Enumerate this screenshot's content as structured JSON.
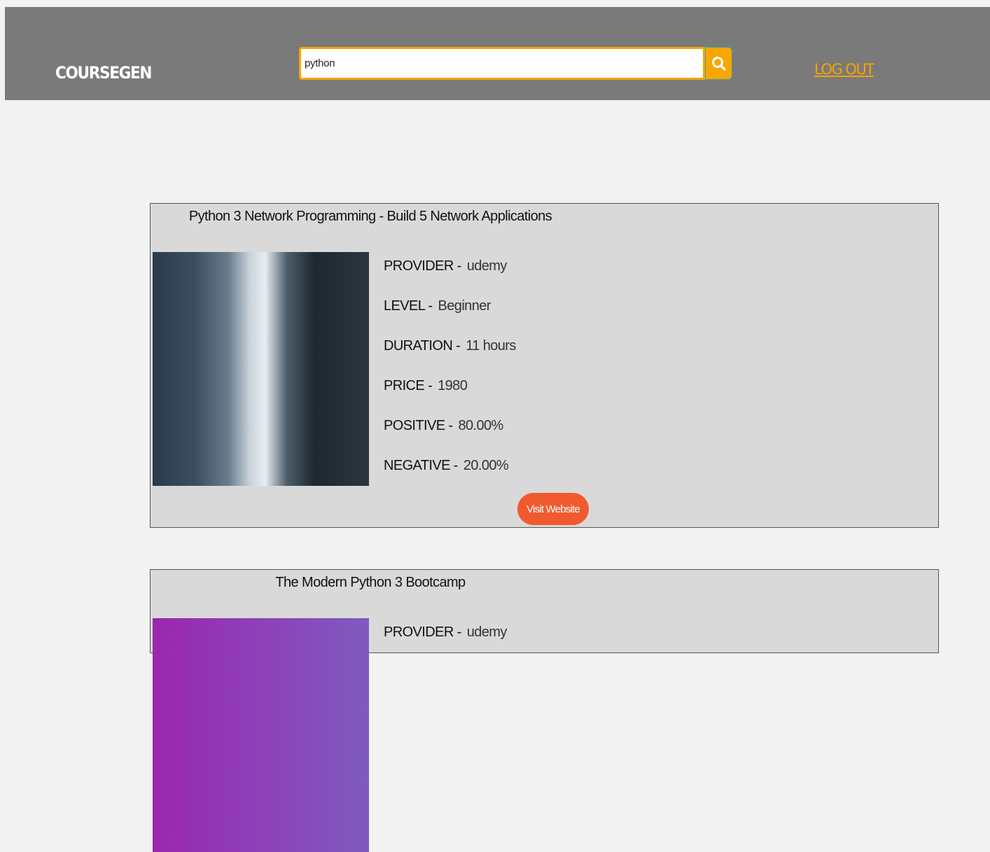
{
  "header": {
    "logo": "COURSEGEN",
    "search_value": "python",
    "search_icon": "search-icon",
    "logout": "LOG OUT"
  },
  "accent": "#f9a602",
  "courses": [
    {
      "title": "Python 3 Network Programming - Build 5 Network Applications",
      "provider_label": "PROVIDER -",
      "provider": "udemy",
      "level_label": "LEVEL -",
      "level": "Beginner",
      "duration_label": "DURATION -",
      "duration": "11 hours",
      "price_label": "PRICE -",
      "price": "1980",
      "positive_label": "POSITIVE -",
      "positive": "80.00%",
      "negative_label": "NEGATIVE -",
      "negative": "20.00%",
      "button": "Visit Website"
    },
    {
      "title": "The Modern Python 3 Bootcamp",
      "provider_label": "PROVIDER -",
      "provider": "udemy"
    }
  ]
}
